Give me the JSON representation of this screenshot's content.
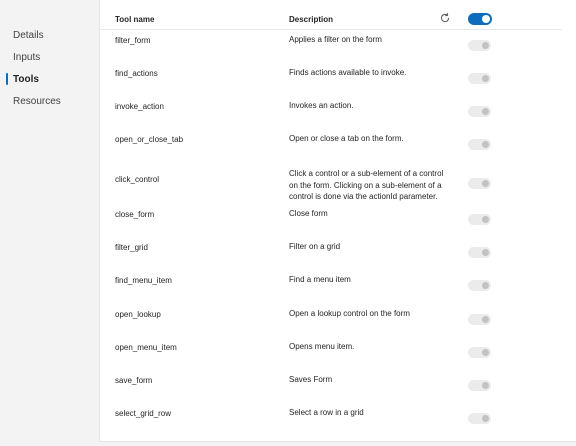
{
  "nav": {
    "items": [
      {
        "label": "Details",
        "active": false
      },
      {
        "label": "Inputs",
        "active": false
      },
      {
        "label": "Tools",
        "active": true
      },
      {
        "label": "Resources",
        "active": false
      }
    ]
  },
  "table": {
    "headers": {
      "name": "Tool name",
      "description": "Description"
    },
    "refresh_icon": "refresh-icon",
    "master_toggle_on": true,
    "colors": {
      "accent": "#0f6cbd",
      "toggle_off": "#ebebeb"
    },
    "rows": [
      {
        "name": "filter_form",
        "description": "Applies a filter on the form",
        "enabled": false
      },
      {
        "name": "find_actions",
        "description": "Finds actions available to invoke.",
        "enabled": false
      },
      {
        "name": "invoke_action",
        "description": "Invokes an action.",
        "enabled": false
      },
      {
        "name": "open_or_close_tab",
        "description": "Open or close a tab on the form.",
        "enabled": false
      },
      {
        "name": "click_control",
        "description": "Click a control or a sub-element of a control on the form. Clicking on a sub-element of a control is done via the actionId parameter.",
        "enabled": false
      },
      {
        "name": "close_form",
        "description": "Close form",
        "enabled": false
      },
      {
        "name": "filter_grid",
        "description": "Filter on a grid",
        "enabled": false
      },
      {
        "name": "find_menu_item",
        "description": "Find a menu item",
        "enabled": false
      },
      {
        "name": "open_lookup",
        "description": "Open a lookup control on the form",
        "enabled": false
      },
      {
        "name": "open_menu_item",
        "description": "Opens menu item.",
        "enabled": false
      },
      {
        "name": "save_form",
        "description": "Saves Form",
        "enabled": false
      },
      {
        "name": "select_grid_row",
        "description": "Select a row in a grid",
        "enabled": false
      }
    ]
  }
}
